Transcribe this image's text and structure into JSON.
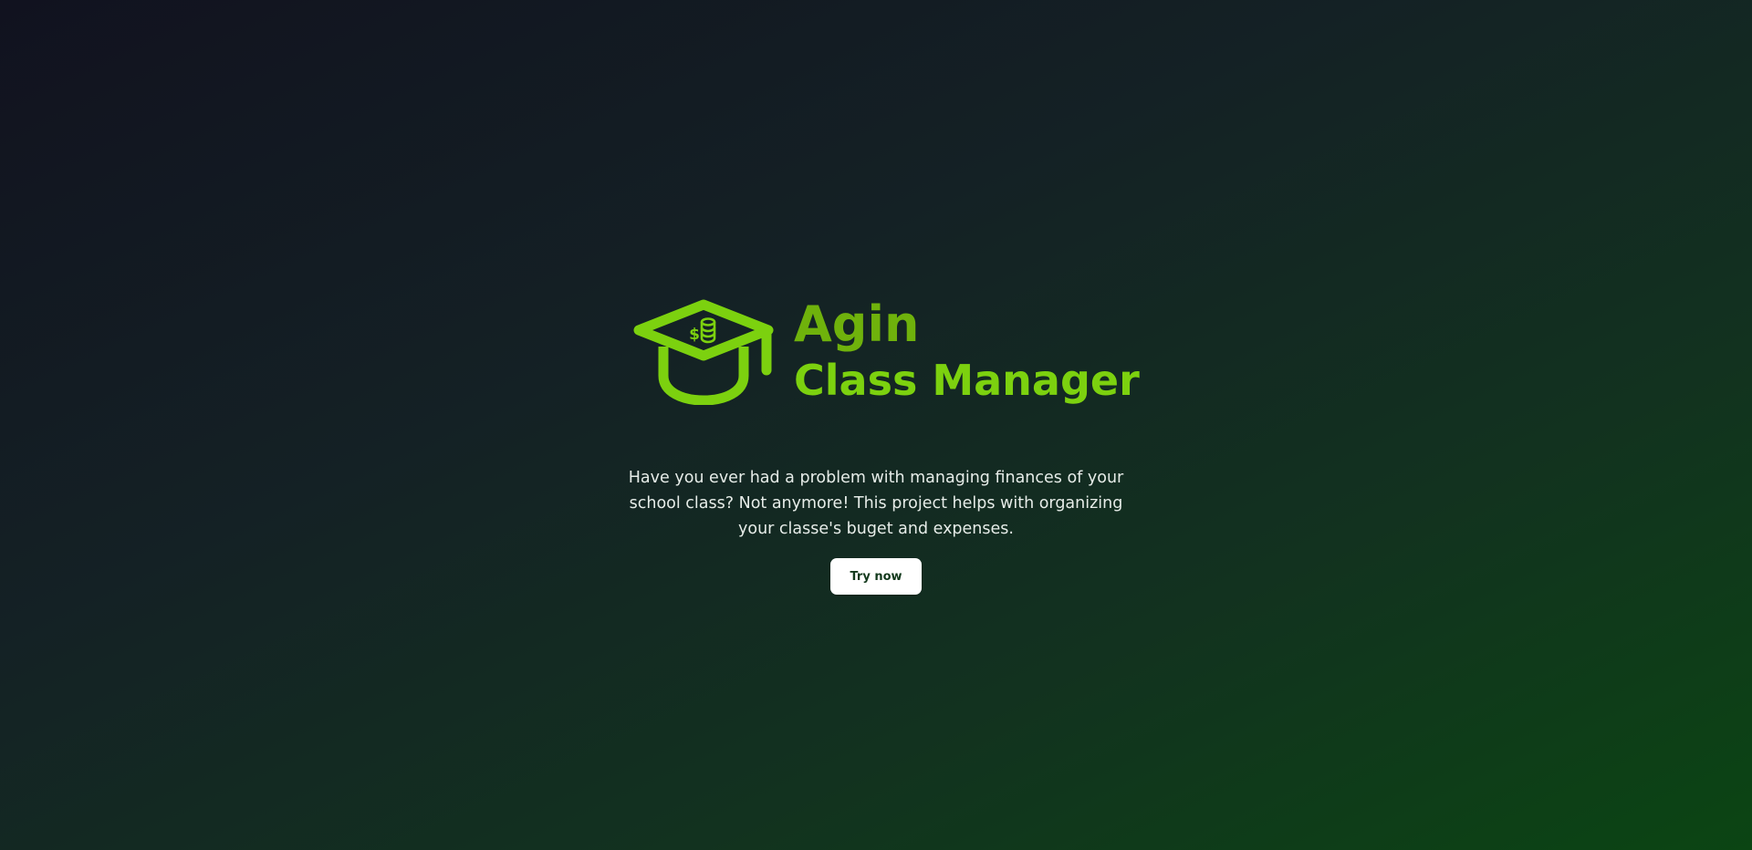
{
  "brand": {
    "name": "Agin",
    "subtitle": "Class Manager",
    "logo_icon": "graduation-cap-coins-icon",
    "primary_color": "#7cd10f",
    "name_color": "#6fb20c"
  },
  "hero": {
    "description": "Have you ever had a problem with managing finances of your school class? Not anymore! This project helps with organizing your classe's buget and expenses.",
    "cta_label": "Try now"
  },
  "colors": {
    "background_start": "#11121f",
    "background_end": "#0b4513",
    "button_background": "#ffffff",
    "button_text": "#12391c",
    "description_text": "#e6ece8"
  }
}
